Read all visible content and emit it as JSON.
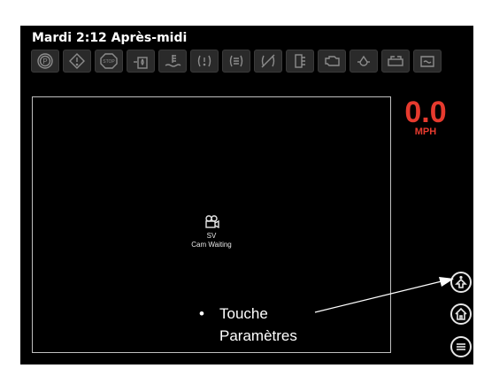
{
  "status_bar": {
    "datetime": "Mardi 2:12 Après-midi"
  },
  "indicator_icons": [
    "parking-brake-icon",
    "warning-icon",
    "stop-icon",
    "water-in-fuel-icon",
    "coolant-temperature-icon",
    "regen-status-icon",
    "dpf-regen-icon",
    "regen-inhibit-icon",
    "def-level-icon",
    "engine-check-icon",
    "oil-pressure-icon",
    "battery-charge-icon",
    "air-filter-icon"
  ],
  "camera": {
    "icon": "camera-icon",
    "label": "SV",
    "status": "Cam Waiting"
  },
  "speed": {
    "value": "0.0",
    "unit": "MPH",
    "color": "#e63a2e"
  },
  "side_buttons": [
    "settings-button",
    "home-button",
    "menu-button"
  ],
  "callout": {
    "bullet": "•",
    "line1": "Touche",
    "line2": "Paramètres"
  }
}
